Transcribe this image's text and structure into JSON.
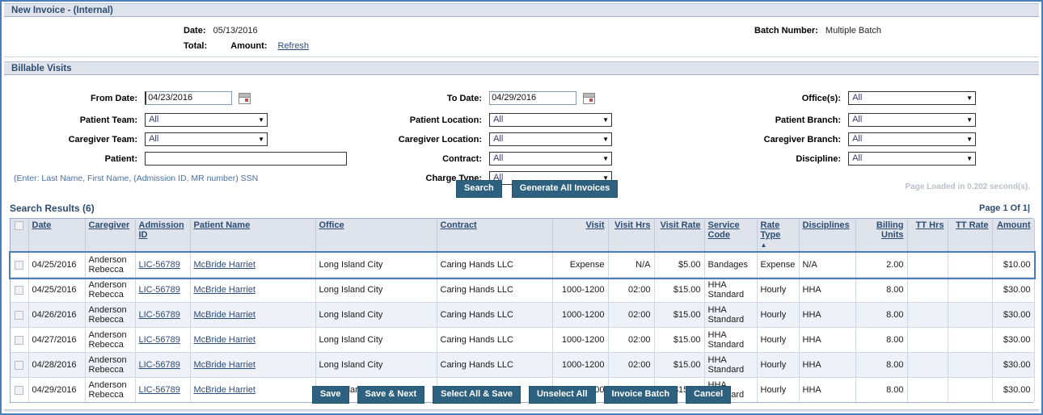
{
  "window": {
    "title": "New Invoice - (Internal)"
  },
  "header": {
    "date_label": "Date:",
    "date_value": "05/13/2016",
    "total_label": "Total:",
    "amount_label": "Amount:",
    "refresh_link": "Refresh",
    "batch_label": "Batch Number:",
    "batch_value": "Multiple Batch"
  },
  "billable": {
    "section_title": "Billable Visits",
    "from_date": {
      "label": "From Date:",
      "value": "04/23/2016",
      "icon": "calendar-icon"
    },
    "to_date": {
      "label": "To Date:",
      "value": "04/29/2016",
      "icon": "calendar-icon"
    },
    "offices": {
      "label": "Office(s):",
      "value": "All"
    },
    "patient_team": {
      "label": "Patient Team:",
      "value": "All"
    },
    "patient_location": {
      "label": "Patient Location:",
      "value": "All"
    },
    "patient_branch": {
      "label": "Patient Branch:",
      "value": "All"
    },
    "caregiver_team": {
      "label": "Caregiver Team:",
      "value": "All"
    },
    "caregiver_location": {
      "label": "Caregiver Location:",
      "value": "All"
    },
    "caregiver_branch": {
      "label": "Caregiver Branch:",
      "value": "All"
    },
    "patient": {
      "label": "Patient:",
      "value": ""
    },
    "contract": {
      "label": "Contract:",
      "value": "All"
    },
    "discipline": {
      "label": "Discipline:",
      "value": "All"
    },
    "charge_type": {
      "label": "Charge Type:",
      "value": "All"
    },
    "hint": "(Enter: Last Name, First Name, (Admission ID, MR number) SSN",
    "search_button": "Search",
    "generate_button": "Generate All Invoices",
    "page_loaded": "Page Loaded in 0.202 second(s)."
  },
  "results": {
    "title": "Search Results  (6)",
    "paging": "Page 1 Of 1|",
    "columns": [
      {
        "key": "check",
        "label": ""
      },
      {
        "key": "date",
        "label": "Date"
      },
      {
        "key": "caregiver",
        "label": "Caregiver"
      },
      {
        "key": "admission_id",
        "label": "Admission ID"
      },
      {
        "key": "patient_name",
        "label": "Patient Name"
      },
      {
        "key": "office",
        "label": "Office"
      },
      {
        "key": "contract",
        "label": "Contract"
      },
      {
        "key": "visit",
        "label": "Visit"
      },
      {
        "key": "visit_hrs",
        "label": "Visit Hrs"
      },
      {
        "key": "visit_rate",
        "label": "Visit Rate"
      },
      {
        "key": "service_code",
        "label": "Service Code"
      },
      {
        "key": "rate_type",
        "label": "Rate Type"
      },
      {
        "key": "disciplines",
        "label": "Disciplines"
      },
      {
        "key": "billing_units",
        "label": "Billing Units"
      },
      {
        "key": "tt_hrs",
        "label": "TT Hrs"
      },
      {
        "key": "tt_rate",
        "label": "TT Rate"
      },
      {
        "key": "amount",
        "label": "Amount"
      }
    ],
    "sorted_column": "rate_type",
    "sort_caret": "▲",
    "rows": [
      {
        "date": "04/25/2016",
        "caregiver": "Anderson Rebecca",
        "admission_id": "LIC-56789",
        "patient_name": "McBride Harriet",
        "office": "Long Island City",
        "contract": "Caring Hands LLC",
        "visit": "Expense",
        "visit_hrs": "N/A",
        "visit_rate": "$5.00",
        "service_code": "Bandages",
        "rate_type": "Expense",
        "disciplines": "N/A",
        "billing_units": "2.00",
        "tt_hrs": "",
        "tt_rate": "",
        "amount": "$10.00",
        "highlighted": true
      },
      {
        "date": "04/25/2016",
        "caregiver": "Anderson Rebecca",
        "admission_id": "LIC-56789",
        "patient_name": "McBride Harriet",
        "office": "Long Island City",
        "contract": "Caring Hands LLC",
        "visit": "1000-1200",
        "visit_hrs": "02:00",
        "visit_rate": "$15.00",
        "service_code": "HHA Standard",
        "rate_type": "Hourly",
        "disciplines": "HHA",
        "billing_units": "8.00",
        "tt_hrs": "",
        "tt_rate": "",
        "amount": "$30.00",
        "highlighted": false
      },
      {
        "date": "04/26/2016",
        "caregiver": "Anderson Rebecca",
        "admission_id": "LIC-56789",
        "patient_name": "McBride Harriet",
        "office": "Long Island City",
        "contract": "Caring Hands LLC",
        "visit": "1000-1200",
        "visit_hrs": "02:00",
        "visit_rate": "$15.00",
        "service_code": "HHA Standard",
        "rate_type": "Hourly",
        "disciplines": "HHA",
        "billing_units": "8.00",
        "tt_hrs": "",
        "tt_rate": "",
        "amount": "$30.00",
        "highlighted": false
      },
      {
        "date": "04/27/2016",
        "caregiver": "Anderson Rebecca",
        "admission_id": "LIC-56789",
        "patient_name": "McBride Harriet",
        "office": "Long Island City",
        "contract": "Caring Hands LLC",
        "visit": "1000-1200",
        "visit_hrs": "02:00",
        "visit_rate": "$15.00",
        "service_code": "HHA Standard",
        "rate_type": "Hourly",
        "disciplines": "HHA",
        "billing_units": "8.00",
        "tt_hrs": "",
        "tt_rate": "",
        "amount": "$30.00",
        "highlighted": false
      },
      {
        "date": "04/28/2016",
        "caregiver": "Anderson Rebecca",
        "admission_id": "LIC-56789",
        "patient_name": "McBride Harriet",
        "office": "Long Island City",
        "contract": "Caring Hands LLC",
        "visit": "1000-1200",
        "visit_hrs": "02:00",
        "visit_rate": "$15.00",
        "service_code": "HHA Standard",
        "rate_type": "Hourly",
        "disciplines": "HHA",
        "billing_units": "8.00",
        "tt_hrs": "",
        "tt_rate": "",
        "amount": "$30.00",
        "highlighted": false
      },
      {
        "date": "04/29/2016",
        "caregiver": "Anderson Rebecca",
        "admission_id": "LIC-56789",
        "patient_name": "McBride Harriet",
        "office": "Long Island City",
        "contract": "Caring Hands LLC",
        "visit": "1000-1200",
        "visit_hrs": "02:00",
        "visit_rate": "$15.00",
        "service_code": "HHA Standard",
        "rate_type": "Hourly",
        "disciplines": "HHA",
        "billing_units": "8.00",
        "tt_hrs": "",
        "tt_rate": "",
        "amount": "$30.00",
        "highlighted": false
      }
    ]
  },
  "footer": {
    "buttons": [
      {
        "key": "save",
        "label": "Save"
      },
      {
        "key": "save_next",
        "label": "Save & Next"
      },
      {
        "key": "select_all_save",
        "label": "Select All & Save"
      },
      {
        "key": "unselect_all",
        "label": "Unselect All"
      },
      {
        "key": "invoice_batch",
        "label": "Invoice Batch"
      },
      {
        "key": "cancel",
        "label": "Cancel"
      }
    ]
  },
  "colors": {
    "accent": "#2e617f",
    "frame": "#4a7ebb",
    "section_bg": "#dfe3ec",
    "header_text": "#2c4c72",
    "alt_row": "#eef1f7"
  }
}
